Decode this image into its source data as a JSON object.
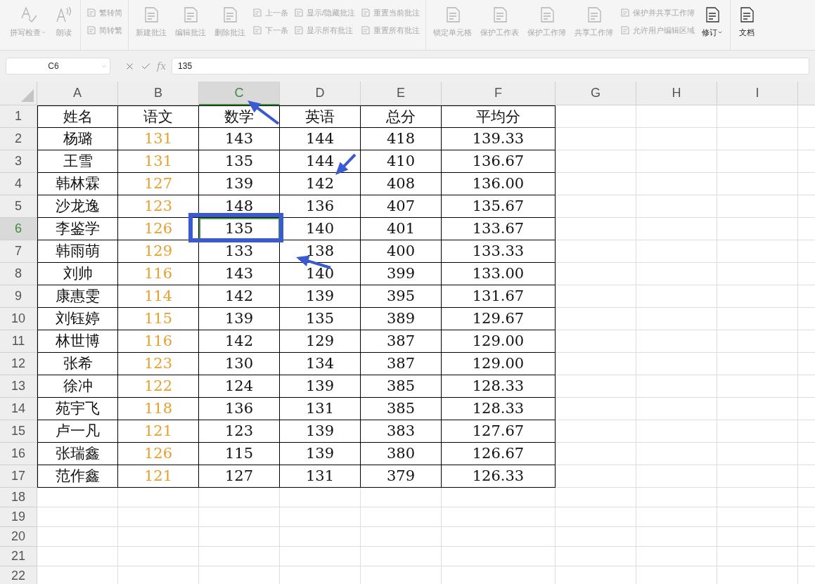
{
  "toolbar": {
    "groups": [
      {
        "items": [
          {
            "kind": "large",
            "label": "拼写检查",
            "dropdown": true,
            "disabled": true
          },
          {
            "kind": "large",
            "label": "朗读",
            "dropdown": false,
            "disabled": true
          }
        ]
      },
      {
        "items": [
          {
            "kind": "small",
            "label": "繁转简",
            "disabled": true
          },
          {
            "kind": "small",
            "label": "简转繁",
            "disabled": true
          }
        ]
      },
      {
        "items": [
          {
            "kind": "large",
            "label": "新建批注",
            "dropdown": false,
            "disabled": true
          },
          {
            "kind": "large",
            "label": "编辑批注",
            "dropdown": false,
            "disabled": true
          },
          {
            "kind": "large",
            "label": "删除批注",
            "dropdown": false,
            "disabled": true
          },
          {
            "kind": "small",
            "label": "上一条",
            "disabled": true
          },
          {
            "kind": "small",
            "label": "下一条",
            "disabled": true
          },
          {
            "kind": "small",
            "label": "显示/隐藏批注",
            "disabled": true
          },
          {
            "kind": "small",
            "label": "显示所有批注",
            "disabled": true
          },
          {
            "kind": "small",
            "label": "重置当前批注",
            "disabled": true
          },
          {
            "kind": "small",
            "label": "重置所有批注",
            "disabled": true
          }
        ]
      },
      {
        "items": [
          {
            "kind": "large",
            "label": "锁定单元格",
            "dropdown": false,
            "disabled": true
          },
          {
            "kind": "large",
            "label": "保护工作表",
            "dropdown": false,
            "disabled": true
          },
          {
            "kind": "large",
            "label": "保护工作簿",
            "dropdown": false,
            "disabled": true
          },
          {
            "kind": "large",
            "label": "共享工作簿",
            "dropdown": false,
            "disabled": true
          },
          {
            "kind": "small",
            "label": "保护并共享工作簿",
            "disabled": true
          },
          {
            "kind": "small",
            "label": "允许用户编辑区域",
            "disabled": true
          },
          {
            "kind": "large",
            "label": "修订",
            "dropdown": true,
            "disabled": false
          }
        ]
      },
      {
        "items": [
          {
            "kind": "large",
            "label": "文档",
            "dropdown": false,
            "disabled": false
          }
        ]
      }
    ]
  },
  "formula_bar": {
    "name_box": "C6",
    "fx_label": "fx",
    "value": "135"
  },
  "sheet": {
    "columns": [
      {
        "label": "A",
        "selected": false
      },
      {
        "label": "B",
        "selected": false,
        "color": "#e8a02c"
      },
      {
        "label": "C",
        "selected": true
      },
      {
        "label": "D",
        "selected": false
      },
      {
        "label": "E",
        "selected": false
      },
      {
        "label": "F",
        "selected": false
      },
      {
        "label": "G",
        "selected": false
      },
      {
        "label": "H",
        "selected": false
      },
      {
        "label": "I",
        "selected": false
      }
    ],
    "rows": [
      {
        "number": "1",
        "kind": "header",
        "selected": false,
        "cells": [
          "姓名",
          "语文",
          "数学",
          "英语",
          "总分",
          "平均分"
        ]
      },
      {
        "number": "2",
        "kind": "data",
        "selected": false,
        "cells": [
          "杨璐",
          "131",
          "143",
          "144",
          "418",
          "139.33"
        ]
      },
      {
        "number": "3",
        "kind": "data",
        "selected": false,
        "cells": [
          "王雪",
          "131",
          "135",
          "144",
          "410",
          "136.67"
        ]
      },
      {
        "number": "4",
        "kind": "data",
        "selected": false,
        "cells": [
          "韩林霖",
          "127",
          "139",
          "142",
          "408",
          "136.00"
        ]
      },
      {
        "number": "5",
        "kind": "data",
        "selected": false,
        "cells": [
          "沙龙逸",
          "123",
          "148",
          "136",
          "407",
          "135.67"
        ]
      },
      {
        "number": "6",
        "kind": "data",
        "selected": true,
        "cells": [
          "李鉴学",
          "126",
          "135",
          "140",
          "401",
          "133.67"
        ]
      },
      {
        "number": "7",
        "kind": "data",
        "selected": false,
        "cells": [
          "韩雨萌",
          "129",
          "133",
          "138",
          "400",
          "133.33"
        ]
      },
      {
        "number": "8",
        "kind": "data",
        "selected": false,
        "cells": [
          "刘帅",
          "116",
          "143",
          "140",
          "399",
          "133.00"
        ]
      },
      {
        "number": "9",
        "kind": "data",
        "selected": false,
        "cells": [
          "康惠雯",
          "114",
          "142",
          "139",
          "395",
          "131.67"
        ]
      },
      {
        "number": "10",
        "kind": "data",
        "selected": false,
        "cells": [
          "刘钰婷",
          "115",
          "139",
          "135",
          "389",
          "129.67"
        ]
      },
      {
        "number": "11",
        "kind": "data",
        "selected": false,
        "cells": [
          "林世博",
          "116",
          "142",
          "129",
          "387",
          "129.00"
        ]
      },
      {
        "number": "12",
        "kind": "data",
        "selected": false,
        "cells": [
          "张希",
          "123",
          "130",
          "134",
          "387",
          "129.00"
        ]
      },
      {
        "number": "13",
        "kind": "data",
        "selected": false,
        "cells": [
          "徐冲",
          "122",
          "124",
          "139",
          "385",
          "128.33"
        ]
      },
      {
        "number": "14",
        "kind": "data",
        "selected": false,
        "cells": [
          "苑宇飞",
          "118",
          "136",
          "131",
          "385",
          "128.33"
        ]
      },
      {
        "number": "15",
        "kind": "data",
        "selected": false,
        "cells": [
          "卢一凡",
          "121",
          "123",
          "139",
          "383",
          "127.67"
        ]
      },
      {
        "number": "16",
        "kind": "data",
        "selected": false,
        "cells": [
          "张瑞鑫",
          "126",
          "115",
          "139",
          "380",
          "126.67"
        ]
      },
      {
        "number": "17",
        "kind": "data",
        "selected": false,
        "cells": [
          "范作鑫",
          "121",
          "127",
          "131",
          "379",
          "126.33"
        ]
      },
      {
        "number": "18",
        "kind": "empty",
        "selected": false
      },
      {
        "number": "19",
        "kind": "empty",
        "selected": false
      },
      {
        "number": "20",
        "kind": "empty",
        "selected": false
      },
      {
        "number": "21",
        "kind": "empty",
        "selected": false
      },
      {
        "number": "22",
        "kind": "empty",
        "selected": false
      }
    ]
  }
}
